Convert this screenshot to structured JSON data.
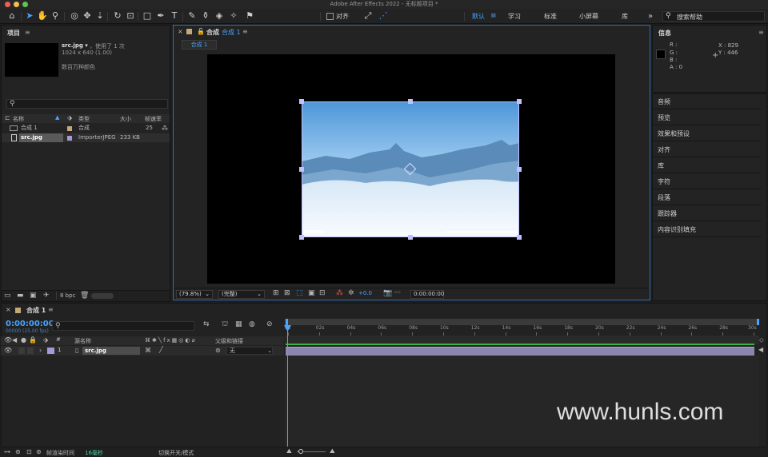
{
  "app": {
    "title": "Adobe After Effects 2022 - 无标题项目 *"
  },
  "toolbar": {
    "align_label": "对齐",
    "workspaces": [
      "默认",
      "学习",
      "标准",
      "小屏幕",
      "库"
    ],
    "more_label": "»",
    "search_placeholder": "搜索帮助"
  },
  "project": {
    "title": "项目",
    "file_name": "src.jpg ▾",
    "used": "，使用了 1 次",
    "dims": "1024 x 640 (1.00)",
    "color": "数百万种颜色",
    "columns": [
      "名称",
      "类型",
      "大小",
      "帧速率"
    ],
    "items": [
      {
        "name": "合成 1",
        "type": "合成",
        "size": "",
        "fps": "25"
      },
      {
        "name": "src.jpg",
        "type": "ImporterJPEG",
        "size": "233 KB",
        "fps": ""
      }
    ],
    "bpc": "8 bpc"
  },
  "comp": {
    "title": "合成",
    "name": "合成 1",
    "tab": "合成 1",
    "zoom": "(79.8%)",
    "resolution": "(完整)",
    "exposure": "+0.0",
    "timecode": "0:00:00:00"
  },
  "info": {
    "title": "信息",
    "r": "R :",
    "g": "G :",
    "b": "B :",
    "a": "A : 0",
    "x": "X : 829",
    "y": "Y : 446"
  },
  "side_panels": [
    "音频",
    "预览",
    "效果和预设",
    "对齐",
    "库",
    "字符",
    "段落",
    "跟踪器",
    "内容识别填充"
  ],
  "timeline": {
    "tab": "合成 1",
    "timecode": "0:00:00:00",
    "fps_note": "00000 (25.00 fps)",
    "columns": {
      "source": "源名称",
      "parent": "父级和链接"
    },
    "layer": {
      "num": "1",
      "name": "src.jpg",
      "parent": "无"
    },
    "ticks": [
      "0s",
      "02s",
      "04s",
      "06s",
      "08s",
      "10s",
      "12s",
      "14s",
      "16s",
      "18s",
      "20s",
      "22s",
      "24s",
      "26s",
      "28s",
      "30s"
    ],
    "render_label": "帧渲染时间",
    "render_value": "16毫秒",
    "toggle_label": "切换开关/模式"
  },
  "watermark": "www.hunls.com",
  "colors": {
    "accent": "#4aa3ff",
    "layer_bar": "#8a86b0"
  }
}
